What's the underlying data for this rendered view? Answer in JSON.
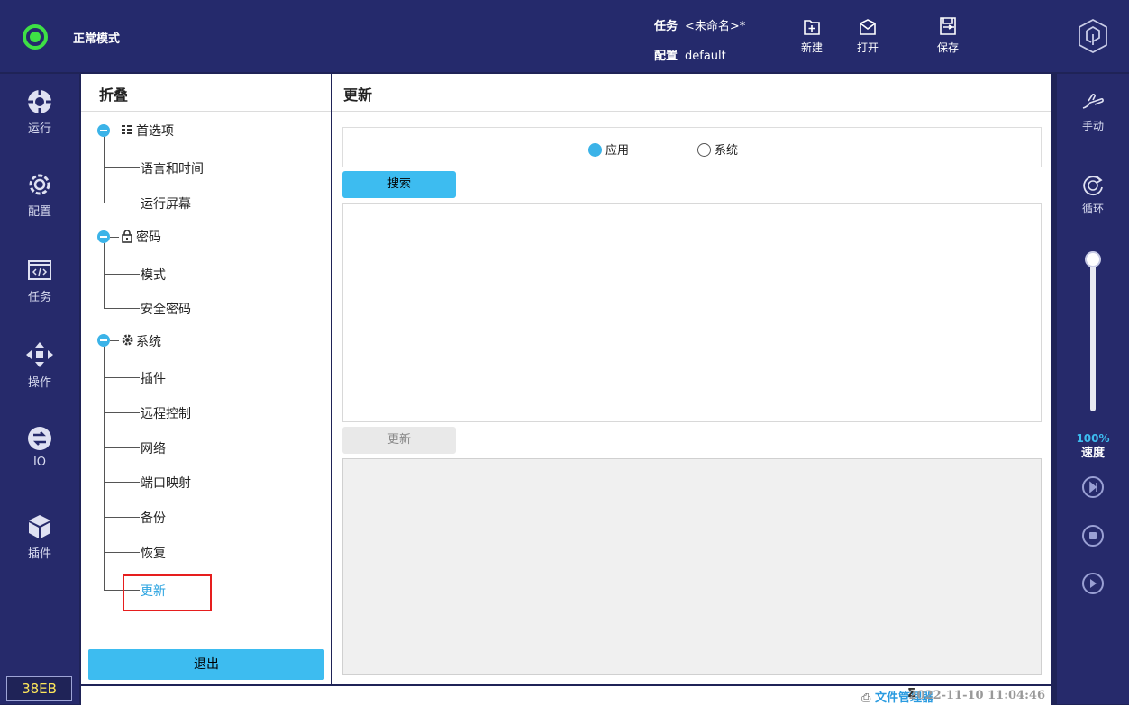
{
  "topbar": {
    "mode_label": "正常模式",
    "task_key": "任务",
    "task_value": "<未命名>*",
    "config_key": "配置",
    "config_value": "default",
    "tools": [
      {
        "label": "新建",
        "icon": "new-file-icon"
      },
      {
        "label": "打开",
        "icon": "open-folder-icon"
      },
      {
        "label": "保存",
        "icon": "save-icon"
      }
    ],
    "logo_icon": "robot-arm-logo-icon",
    "status_color": "#3ee045"
  },
  "leftnav": {
    "items": [
      {
        "label": "运行",
        "icon": "run-icon"
      },
      {
        "label": "配置",
        "icon": "gear-icon"
      },
      {
        "label": "任务",
        "icon": "code-icon"
      },
      {
        "label": "操作",
        "icon": "move-arrows-icon"
      },
      {
        "label": "IO",
        "icon": "io-icon"
      },
      {
        "label": "插件",
        "icon": "cube-icon"
      }
    ],
    "board_id": "38EB"
  },
  "rightnav": {
    "manual_label": "手动",
    "loop_label": "循环",
    "speed_value": "100%",
    "speed_label": "速度",
    "speed_fraction": 1.0,
    "controls": [
      "step-icon",
      "stop-icon",
      "play-icon"
    ]
  },
  "tree": {
    "header": "折叠",
    "groups": [
      {
        "label": "首选项",
        "icon": "list-icon",
        "children": [
          "语言和时间",
          "运行屏幕"
        ]
      },
      {
        "label": "密码",
        "icon": "lock-icon",
        "children": [
          "模式",
          "安全密码"
        ]
      },
      {
        "label": "系统",
        "icon": "gear-small-icon",
        "children": [
          "插件",
          "远程控制",
          "网络",
          "端口映射",
          "备份",
          "恢复",
          "更新"
        ]
      }
    ],
    "selected": "更新",
    "exit_label": "退出"
  },
  "main": {
    "header": "更新",
    "radio_options": [
      {
        "label": "应用",
        "checked": true
      },
      {
        "label": "系统",
        "checked": false
      }
    ],
    "search_label": "搜索",
    "update_label": "更新",
    "accent_color": "#3dbcf0"
  },
  "statusbar": {
    "file_manager_label": "文件管理器",
    "timestamp": "2022-11-10 11:04:46"
  }
}
